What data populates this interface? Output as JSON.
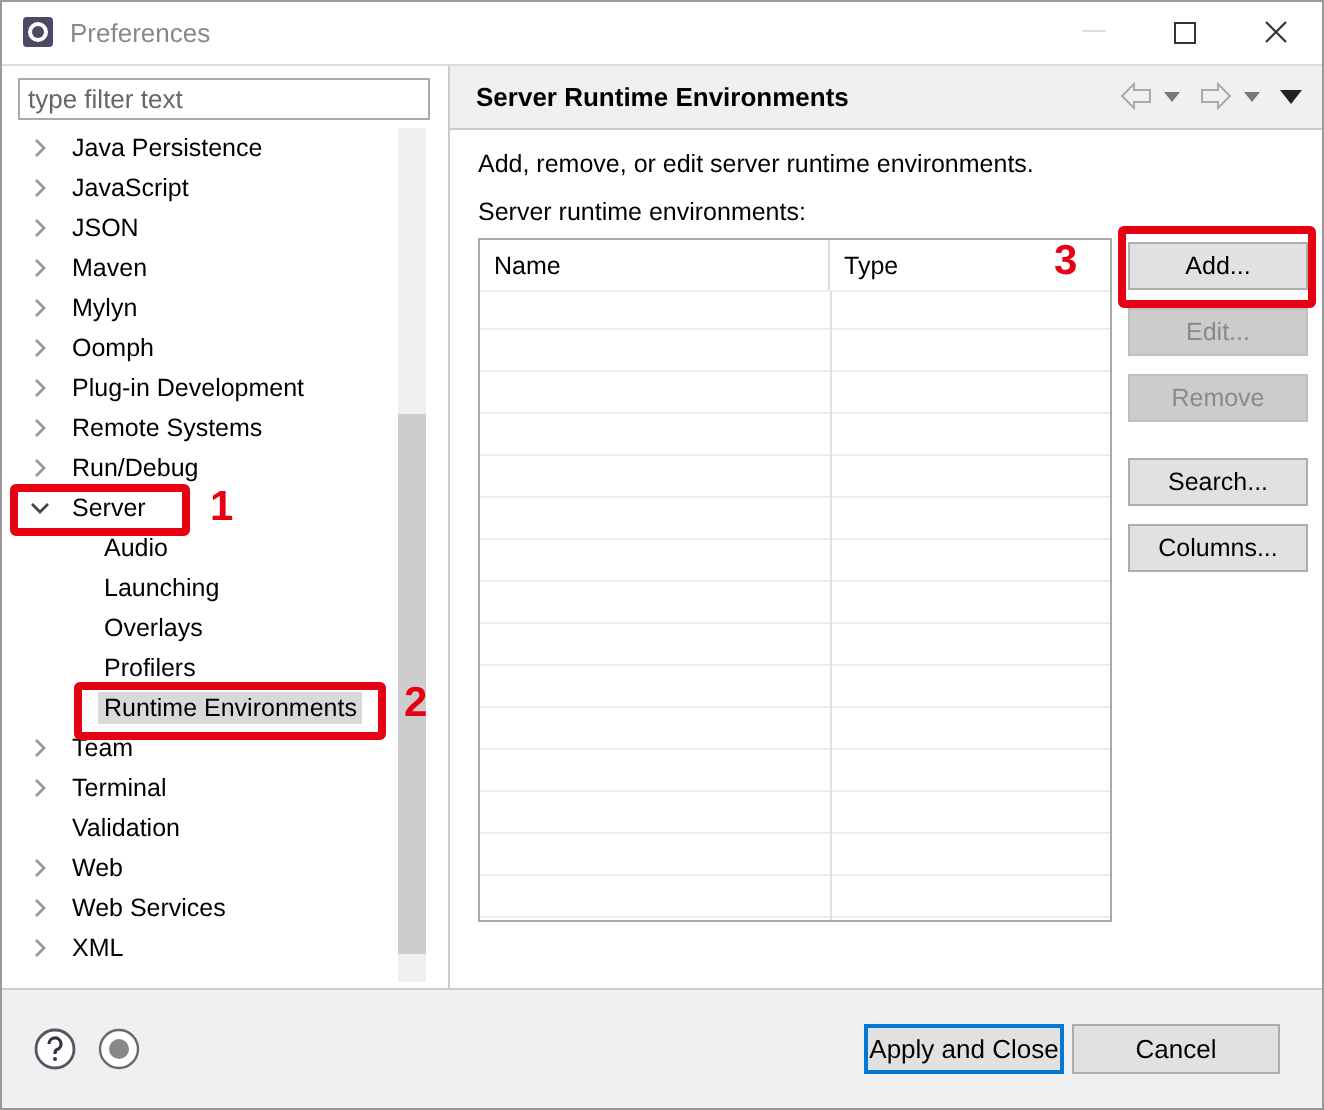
{
  "window": {
    "title": "Preferences"
  },
  "filter": {
    "placeholder": "type filter text"
  },
  "tree": [
    {
      "label": "Java Persistence",
      "kind": "branch",
      "expanded": false,
      "selected": false
    },
    {
      "label": "JavaScript",
      "kind": "branch",
      "expanded": false,
      "selected": false
    },
    {
      "label": "JSON",
      "kind": "branch",
      "expanded": false,
      "selected": false
    },
    {
      "label": "Maven",
      "kind": "branch",
      "expanded": false,
      "selected": false
    },
    {
      "label": "Mylyn",
      "kind": "branch",
      "expanded": false,
      "selected": false
    },
    {
      "label": "Oomph",
      "kind": "branch",
      "expanded": false,
      "selected": false
    },
    {
      "label": "Plug-in Development",
      "kind": "branch",
      "expanded": false,
      "selected": false
    },
    {
      "label": "Remote Systems",
      "kind": "branch",
      "expanded": false,
      "selected": false
    },
    {
      "label": "Run/Debug",
      "kind": "branch",
      "expanded": false,
      "selected": false
    },
    {
      "label": "Server",
      "kind": "branch",
      "expanded": true,
      "selected": false,
      "children": [
        {
          "label": "Audio",
          "kind": "leaf",
          "selected": false
        },
        {
          "label": "Launching",
          "kind": "leaf",
          "selected": false
        },
        {
          "label": "Overlays",
          "kind": "leaf",
          "selected": false
        },
        {
          "label": "Profilers",
          "kind": "leaf",
          "selected": false
        },
        {
          "label": "Runtime Environments",
          "kind": "leaf",
          "selected": true
        }
      ]
    },
    {
      "label": "Team",
      "kind": "branch",
      "expanded": false,
      "selected": false
    },
    {
      "label": "Terminal",
      "kind": "branch",
      "expanded": false,
      "selected": false
    },
    {
      "label": "Validation",
      "kind": "leaf",
      "selected": false
    },
    {
      "label": "Web",
      "kind": "branch",
      "expanded": false,
      "selected": false
    },
    {
      "label": "Web Services",
      "kind": "branch",
      "expanded": false,
      "selected": false
    },
    {
      "label": "XML",
      "kind": "branch",
      "expanded": false,
      "selected": false
    }
  ],
  "page": {
    "title": "Server Runtime Environments",
    "description": "Add, remove, or edit server runtime environments.",
    "list_label": "Server runtime environments:",
    "columns": [
      "Name",
      "Type"
    ],
    "buttons": [
      {
        "label": "Add...",
        "disabled": false
      },
      {
        "label": "Edit...",
        "disabled": true
      },
      {
        "label": "Remove",
        "disabled": true
      }
    ],
    "more_buttons": [
      {
        "label": "Search...",
        "disabled": false
      },
      {
        "label": "Columns...",
        "disabled": false
      }
    ]
  },
  "footer": {
    "buttons": [
      {
        "label": "Apply and Close",
        "default": true
      },
      {
        "label": "Cancel",
        "default": false
      }
    ]
  },
  "annotations": [
    {
      "label": "1"
    },
    {
      "label": "2"
    },
    {
      "label": "3"
    }
  ]
}
